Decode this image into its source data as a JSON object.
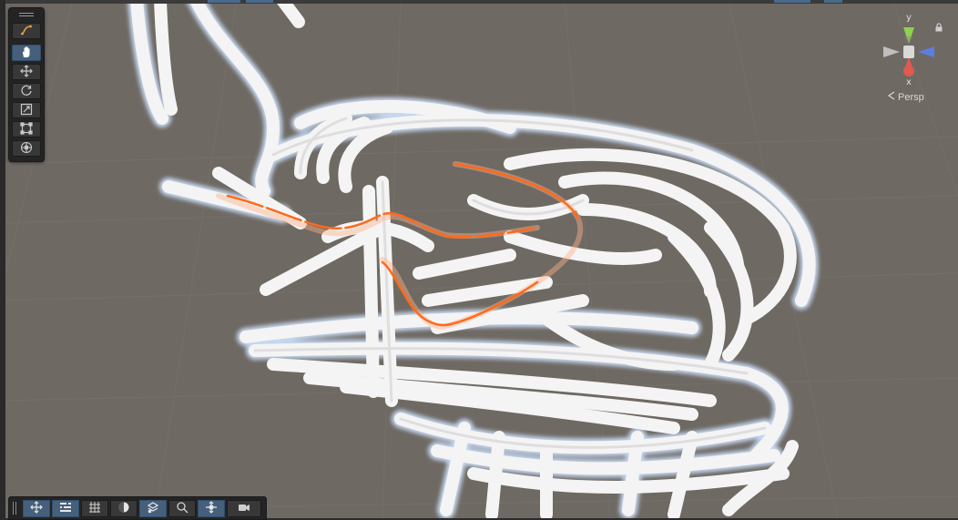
{
  "tools": {
    "items": [
      {
        "name": "view-tool-icon",
        "active": false
      },
      {
        "name": "hand-tool-icon",
        "active": true
      },
      {
        "name": "move-tool-icon",
        "active": false
      },
      {
        "name": "rotate-tool-icon",
        "active": false
      },
      {
        "name": "scale-tool-icon",
        "active": false
      },
      {
        "name": "rect-tool-icon",
        "active": false
      },
      {
        "name": "transform-tool-icon",
        "active": false
      }
    ]
  },
  "bottom_overlay": {
    "items": [
      {
        "name": "move-handle-icon",
        "active": true
      },
      {
        "name": "settings-sliders-icon",
        "active": true
      },
      {
        "name": "grid-icon",
        "active": false
      },
      {
        "name": "shading-icon",
        "active": false
      },
      {
        "name": "layers-icon",
        "active": true
      },
      {
        "name": "zoom-icon",
        "active": false
      },
      {
        "name": "pivot-icon",
        "active": true
      },
      {
        "name": "camera-icon",
        "active": false
      }
    ]
  },
  "gizmo": {
    "y_label": "y",
    "x_label": "x",
    "projection": "Persp",
    "colors": {
      "y": "#8fd14f",
      "x": "#e05a52",
      "z": "#5b7fe0",
      "neutral": "#bfbfbf"
    }
  },
  "scene": {
    "background": "#6e6963",
    "tube_color": "#f2f2f2",
    "selection_color": "#ff6a1a"
  }
}
